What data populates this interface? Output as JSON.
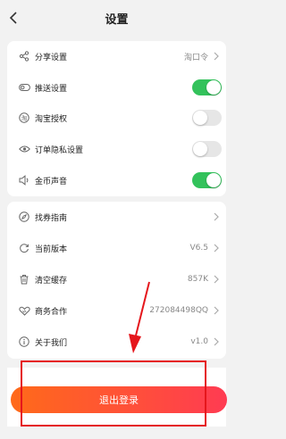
{
  "header": {
    "title": "设置"
  },
  "group1": [
    {
      "icon": "share-icon",
      "label": "分享设置",
      "value": "淘口令",
      "type": "link"
    },
    {
      "icon": "push-toggle-icon",
      "label": "推送设置",
      "type": "toggle",
      "on": true
    },
    {
      "icon": "taobao-icon",
      "label": "淘宝授权",
      "type": "toggle",
      "on": false
    },
    {
      "icon": "eye-icon",
      "label": "订单隐私设置",
      "type": "toggle",
      "on": false
    },
    {
      "icon": "speaker-icon",
      "label": "金币声音",
      "type": "toggle",
      "on": true
    }
  ],
  "group2": [
    {
      "icon": "compass-icon",
      "label": "找券指南",
      "value": "",
      "type": "link"
    },
    {
      "icon": "refresh-icon",
      "label": "当前版本",
      "value": "V6.5",
      "type": "link"
    },
    {
      "icon": "trash-icon",
      "label": "清空缓存",
      "value": "857K",
      "type": "link"
    },
    {
      "icon": "handshake-icon",
      "label": "商务合作",
      "value": "272084498QQ",
      "type": "link"
    },
    {
      "icon": "info-icon",
      "label": "关于我们",
      "value": "v1.0",
      "type": "link"
    }
  ],
  "logout": {
    "label": "退出登录"
  },
  "colors": {
    "toggle_on": "#33c25b",
    "toggle_off": "#e6e6e6",
    "logout_start": "#ff6a1a",
    "logout_end": "#ff3b52",
    "annotation": "#e5161c"
  }
}
